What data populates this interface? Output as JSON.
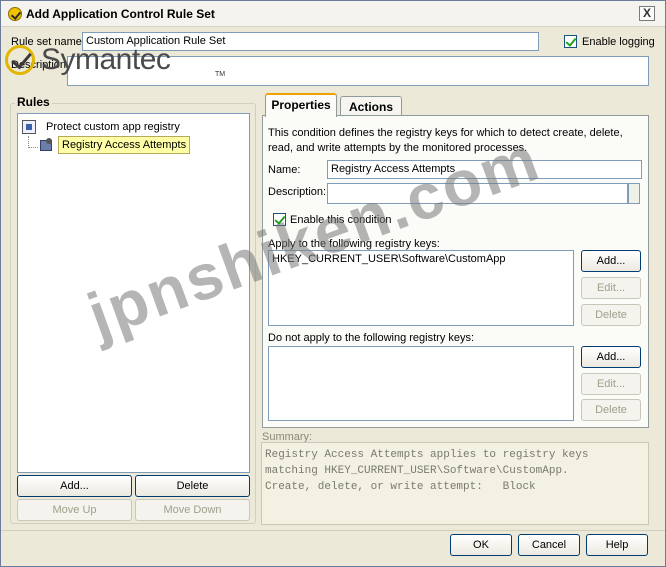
{
  "window": {
    "title": "Add Application Control Rule Set",
    "close_glyph": "X"
  },
  "top": {
    "rule_set_name_label": "Rule set name:",
    "rule_set_name_value": "Custom Application Rule Set",
    "enable_logging_label": "Enable logging",
    "enable_logging_checked": true,
    "description_label": "Description:",
    "description_value": ""
  },
  "branding": {
    "logo_text": "Symantec",
    "trademark": "TM",
    "watermark": "jpnshiken.com"
  },
  "rules": {
    "group_title": "Rules",
    "items": [
      {
        "label": "Protect custom app registry",
        "icon": "rule-icon"
      },
      {
        "label": "Registry Access Attempts",
        "icon": "condition-icon",
        "selected": true
      }
    ],
    "add_label": "Add...",
    "delete_label": "Delete",
    "move_up_label": "Move Up",
    "move_down_label": "Move Down"
  },
  "tabs": [
    {
      "label": "Properties",
      "active": true
    },
    {
      "label": "Actions",
      "active": false
    }
  ],
  "properties": {
    "intro": "This condition defines the registry keys for which to detect create, delete, read, and write attempts by the monitored processes.",
    "name_label": "Name:",
    "name_value": "Registry Access Attempts",
    "description_label": "Description:",
    "description_value": "",
    "enable_condition_label": "Enable this condition",
    "enable_condition_checked": true,
    "apply_label": "Apply to the following registry keys:",
    "apply_keys": [
      "HKEY_CURRENT_USER\\Software\\CustomApp"
    ],
    "not_apply_label": "Do not apply to the following registry keys:",
    "not_apply_keys": [],
    "add_label": "Add...",
    "edit_label": "Edit...",
    "delete_label": "Delete"
  },
  "summary": {
    "label": "Summary:",
    "text": "Registry Access Attempts applies to registry keys\nmatching HKEY_CURRENT_USER\\Software\\CustomApp.\nCreate, delete, or write attempt:   Block"
  },
  "footer": {
    "ok_label": "OK",
    "cancel_label": "Cancel",
    "help_label": "Help"
  }
}
